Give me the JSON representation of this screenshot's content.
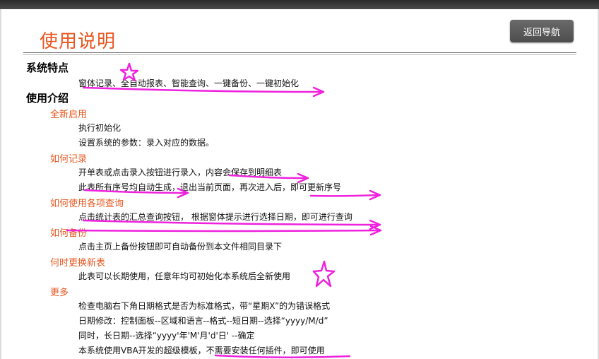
{
  "title": "使用说明",
  "back_button": "返回导航",
  "features": {
    "heading": "系统特点",
    "text": "窗体记录、全自动报表、智能查询、一键备份、一键初始化"
  },
  "usage": {
    "heading": "使用介绍",
    "sections": [
      {
        "title": "全新启用",
        "lines": [
          "执行初始化",
          "设置系统的参数：录入对应的数据。"
        ]
      },
      {
        "title": "如何记录",
        "lines": [
          "开单表或点击录入按钮进行录入，内容会保存到明细表",
          "此表所有序号均自动生成，退出当前页面，再次进入后，即可更新序号"
        ]
      },
      {
        "title": "如何使用各项查询",
        "lines": [
          "点击统计表的汇总查询按钮， 根据窗体提示进行选择日期，即可进行查询"
        ]
      },
      {
        "title": "如何备份",
        "lines": [
          "点击主页上备份按钮即可自动备份到本文件相同目录下"
        ]
      },
      {
        "title": "何时更换新表",
        "lines": [
          "此表可以长期使用，任意年均可初始化本系统后全新使用"
        ]
      },
      {
        "title": "更多",
        "lines": [
          "检查电脑右下角日期格式是否为标准格式，带“星期X”的为错误格式",
          "日期修改：控制面板--区域和语言--格式--短日期--选择“yyyy/M/d”",
          "同时，长日期--选择“yyyy'年'M'月'd'日' --确定",
          "本系统使用VBA开发的超级模板，不需要安装任何插件，即可使用"
        ]
      }
    ]
  },
  "annotation_color": "#ee22dd"
}
